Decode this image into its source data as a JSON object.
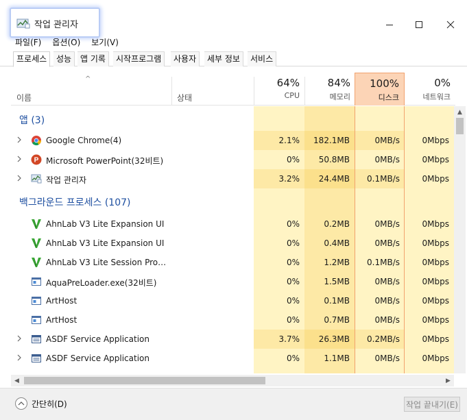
{
  "window": {
    "title": "작업 관리자",
    "title_icon": "task-manager-icon",
    "controls": [
      "minimize-icon",
      "maximize-icon",
      "close-icon"
    ]
  },
  "menu": {
    "items": [
      "파일(F)",
      "옵션(O)",
      "보기(V)"
    ]
  },
  "tabs": {
    "items": [
      "프로세스",
      "성능",
      "앱 기록",
      "시작프로그램",
      "사용자",
      "세부 정보",
      "서비스"
    ],
    "active": "프로세스"
  },
  "columns": {
    "sort_indicator": "^",
    "name": "이름",
    "status": "상태",
    "cpu": {
      "percent": "64%",
      "label": "CPU"
    },
    "memory": {
      "percent": "84%",
      "label": "메모리"
    },
    "disk": {
      "percent": "100%",
      "label": "디스크"
    },
    "network": {
      "percent": "0%",
      "label": "네트워크"
    }
  },
  "groups": {
    "apps": {
      "title": "앱 (3)",
      "rows": [
        {
          "name": "Google Chrome(4)",
          "icon": "chrome-icon",
          "expandable": true,
          "cpu": "2.1%",
          "memory": "182.1MB",
          "disk": "0MB/s",
          "network": "0Mbps",
          "cpu_hl": true
        },
        {
          "name": "Microsoft PowerPoint(32비트)",
          "icon": "powerpoint-icon",
          "expandable": true,
          "cpu": "0%",
          "memory": "50.8MB",
          "disk": "0MB/s",
          "network": "0Mbps",
          "cpu_hl": false
        },
        {
          "name": "작업 관리자",
          "icon": "task-manager-icon",
          "expandable": true,
          "cpu": "3.2%",
          "memory": "24.4MB",
          "disk": "0.1MB/s",
          "network": "0Mbps",
          "cpu_hl": true
        }
      ]
    },
    "background": {
      "title": "백그라운드 프로세스 (107)",
      "rows": [
        {
          "name": "AhnLab V3 Lite Expansion UI",
          "icon": "ahnlab-v3-icon",
          "expandable": false,
          "cpu": "0%",
          "memory": "0.2MB",
          "disk": "0MB/s",
          "network": "0Mbps",
          "cpu_hl": false
        },
        {
          "name": "AhnLab V3 Lite Expansion UI",
          "icon": "ahnlab-v3-icon",
          "expandable": false,
          "cpu": "0%",
          "memory": "0.4MB",
          "disk": "0MB/s",
          "network": "0Mbps",
          "cpu_hl": false
        },
        {
          "name": "AhnLab V3 Lite Session Proces...",
          "icon": "ahnlab-v3-icon",
          "expandable": false,
          "cpu": "0%",
          "memory": "1.2MB",
          "disk": "0.1MB/s",
          "network": "0Mbps",
          "cpu_hl": false
        },
        {
          "name": "AquaPreLoader.exe(32비트)",
          "icon": "app-window-icon",
          "expandable": false,
          "cpu": "0%",
          "memory": "1.5MB",
          "disk": "0MB/s",
          "network": "0Mbps",
          "cpu_hl": false
        },
        {
          "name": "ArtHost",
          "icon": "app-window-icon",
          "expandable": false,
          "cpu": "0%",
          "memory": "0.1MB",
          "disk": "0MB/s",
          "network": "0Mbps",
          "cpu_hl": false
        },
        {
          "name": "ArtHost",
          "icon": "app-window-icon",
          "expandable": false,
          "cpu": "0%",
          "memory": "0.7MB",
          "disk": "0MB/s",
          "network": "0Mbps",
          "cpu_hl": false
        },
        {
          "name": "ASDF Service Application",
          "icon": "service-app-icon",
          "expandable": true,
          "cpu": "3.7%",
          "memory": "26.3MB",
          "disk": "0.2MB/s",
          "network": "0Mbps",
          "cpu_hl": true
        },
        {
          "name": "ASDF Service Application",
          "icon": "service-app-icon",
          "expandable": true,
          "cpu": "0%",
          "memory": "1.1MB",
          "disk": "0MB/s",
          "network": "0Mbps",
          "cpu_hl": false
        }
      ]
    }
  },
  "colors": {
    "cpu_bg": "#fff4c4",
    "cpu_bg_hl": "#fde9a6",
    "memory_bg": "#fde9a6",
    "memory_bg_hl": "#fbe08c",
    "disk_bg": "#fff4c4",
    "disk_bg_hl": "#fde9a6",
    "network_bg": "#fff4c4",
    "disk_border": "#f1a26d",
    "group_text": "#1e4fa0"
  },
  "footer": {
    "collapse_label": "간단히(D)",
    "end_task_label": "작업 끝내기(E)"
  }
}
